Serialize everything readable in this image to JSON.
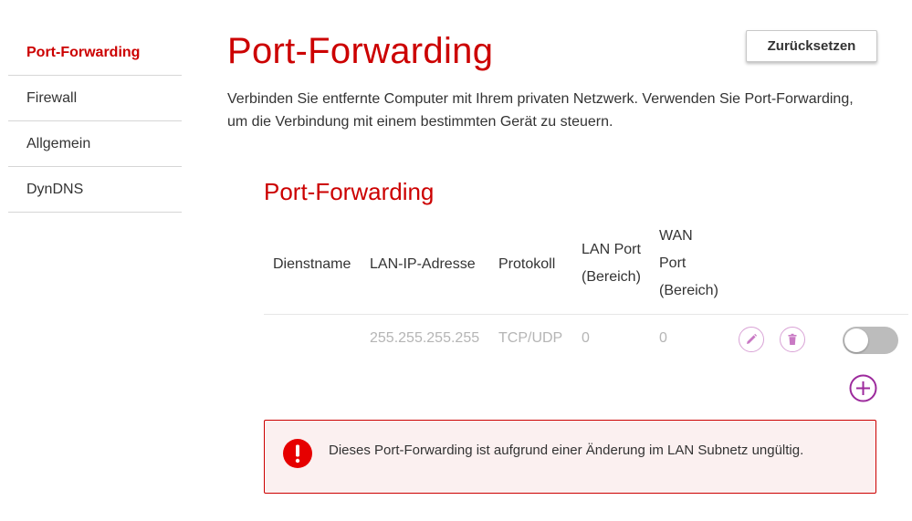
{
  "sidebar": {
    "items": [
      {
        "label": "Port-Forwarding",
        "active": true
      },
      {
        "label": "Firewall",
        "active": false
      },
      {
        "label": "Allgemein",
        "active": false
      },
      {
        "label": "DynDNS",
        "active": false
      }
    ]
  },
  "header": {
    "title": "Port-Forwarding",
    "reset_label": "Zurücksetzen",
    "description": "Verbinden Sie entfernte Computer mit Ihrem privaten Netzwerk. Verwenden Sie Port-Forwarding, um die Verbindung mit einem bestimmten Gerät zu steuern."
  },
  "section": {
    "title": "Port-Forwarding",
    "columns": {
      "service": "Dienstname",
      "lan_ip": "LAN-IP-Adresse",
      "protocol": "Protokoll",
      "lan_port": [
        "LAN Port",
        "(Bereich)"
      ],
      "wan_port": [
        "WAN",
        "Port",
        "(Bereich)"
      ]
    },
    "rows": [
      {
        "service": "",
        "lan_ip": "255.255.255.255",
        "protocol": "TCP/UDP",
        "lan_port": "0",
        "wan_port": "0",
        "enabled": false
      }
    ]
  },
  "error": {
    "message": "Dieses Port-Forwarding ist aufgrund einer Änderung im LAN Subnetz ungültig."
  },
  "colors": {
    "accent": "#cc0000",
    "icon_purple": "#9c2a9c",
    "toggle_off": "#bcbcbc",
    "error_bg": "#fbf0f0"
  },
  "icons": [
    "pencil-icon",
    "trash-icon",
    "plus-circle-icon",
    "exclamation-circle-icon"
  ]
}
